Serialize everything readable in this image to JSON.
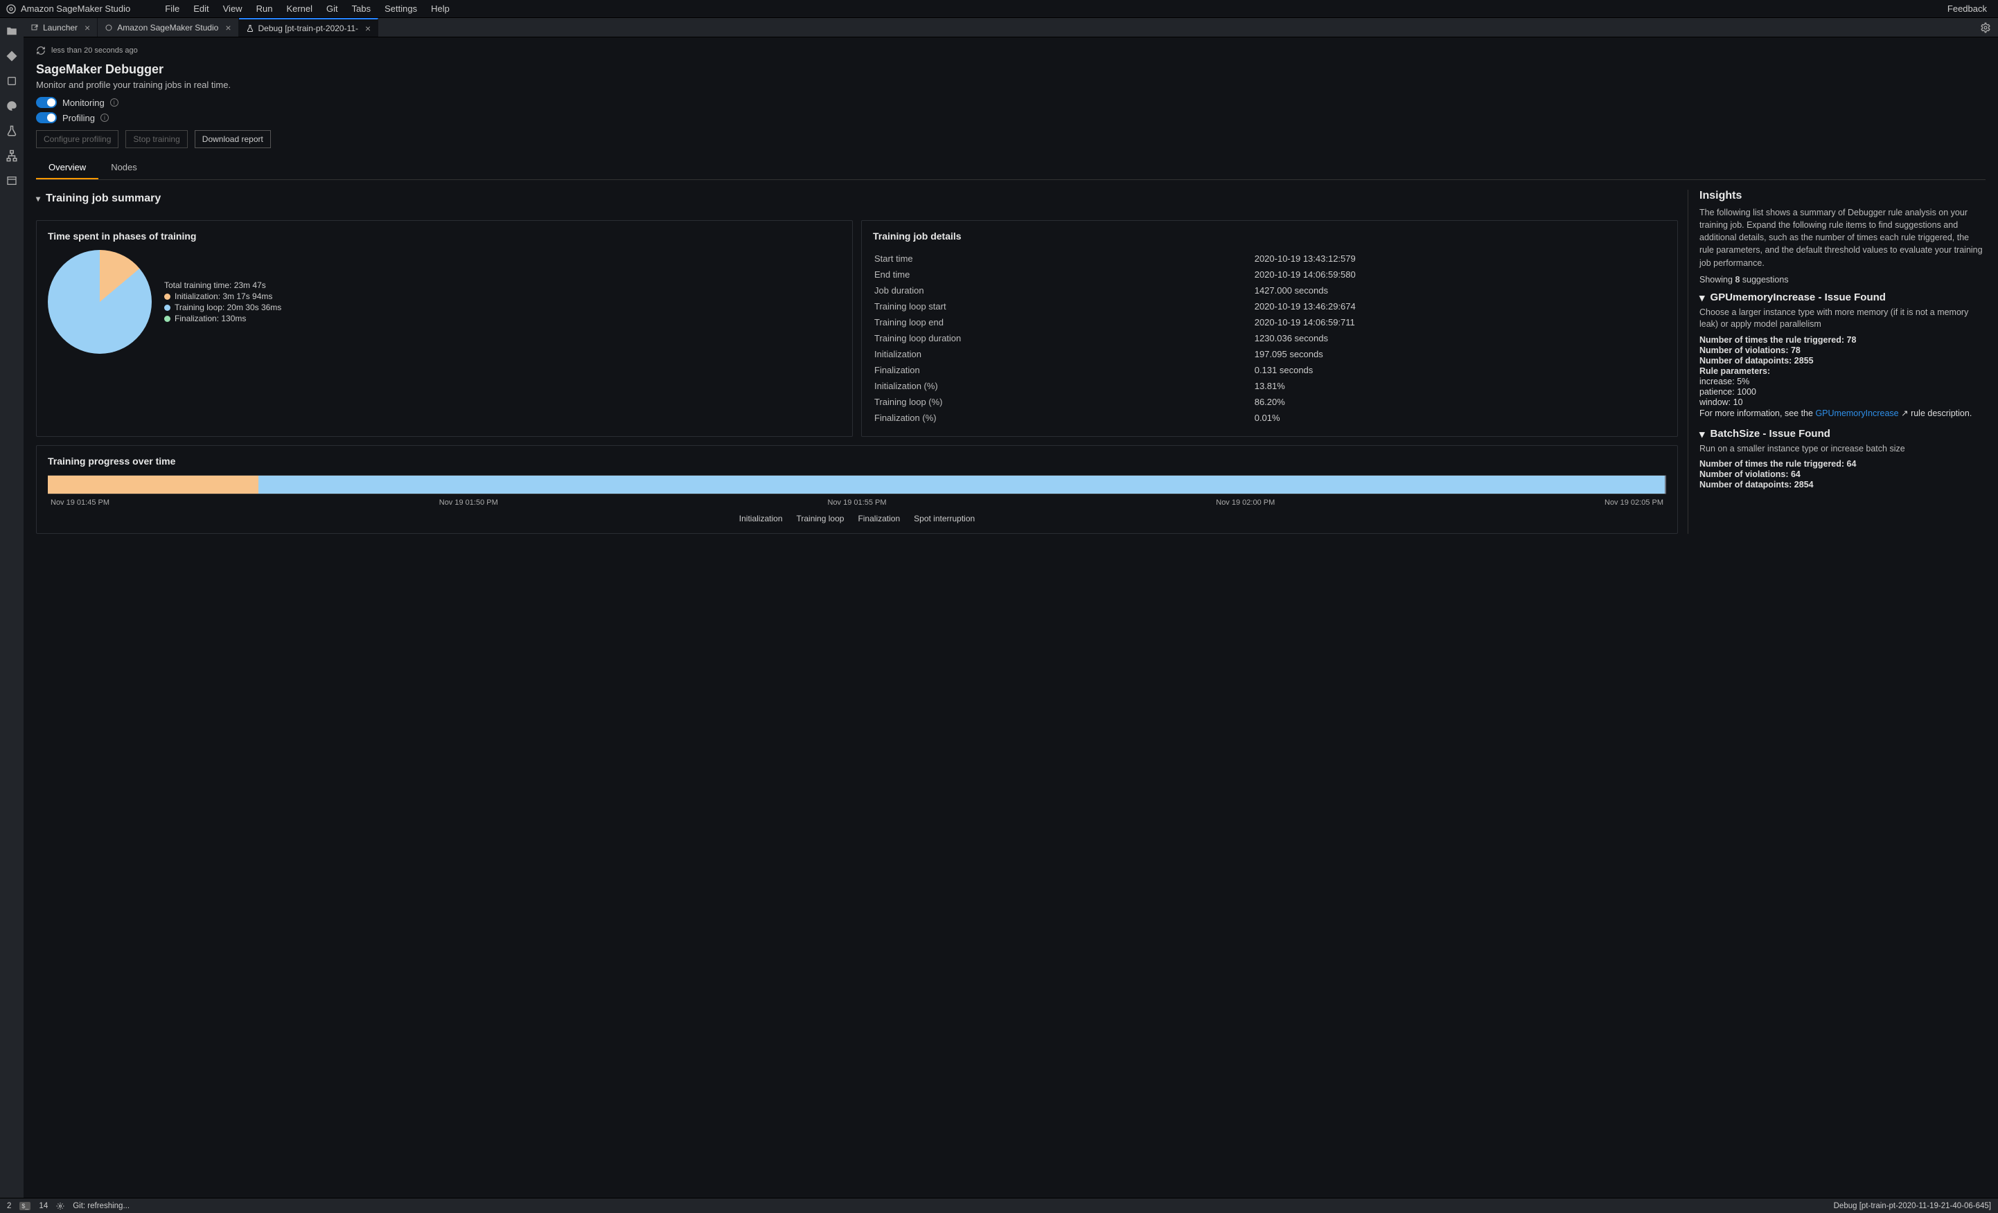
{
  "menubar": {
    "brand": "Amazon SageMaker Studio",
    "items": [
      "File",
      "Edit",
      "View",
      "Run",
      "Kernel",
      "Git",
      "Tabs",
      "Settings",
      "Help"
    ],
    "feedback": "Feedback"
  },
  "tabs": [
    {
      "label": "Launcher",
      "icon": "launch-icon",
      "active": false
    },
    {
      "label": "Amazon SageMaker Studio",
      "icon": "sagemaker-icon",
      "active": false
    },
    {
      "label": "Debug [pt-train-pt-2020-11-",
      "icon": "flask-icon",
      "active": true
    }
  ],
  "refresh": {
    "label": "less than 20 seconds ago"
  },
  "header": {
    "title": "SageMaker Debugger",
    "subtitle": "Monitor and profile your training jobs in real time."
  },
  "toggles": {
    "monitoring": {
      "label": "Monitoring",
      "on": true
    },
    "profiling": {
      "label": "Profiling",
      "on": true
    }
  },
  "buttons": {
    "configure": "Configure profiling",
    "stop": "Stop training",
    "download": "Download report"
  },
  "viewtabs": {
    "overview": "Overview",
    "nodes": "Nodes"
  },
  "summary": {
    "section": "Training job summary",
    "phasesTitle": "Time spent in phases of training",
    "totalTime": "Total training time: 23m 47s",
    "legend": {
      "init": "Initialization: 3m 17s 94ms",
      "loop": "Training loop: 20m 30s 36ms",
      "final": "Finalization: 130ms"
    },
    "detailsTitle": "Training job details",
    "details": [
      [
        "Start time",
        "2020-10-19 13:43:12:579"
      ],
      [
        "End time",
        "2020-10-19 14:06:59:580"
      ],
      [
        "Job duration",
        "1427.000 seconds"
      ],
      [
        "Training loop start",
        "2020-10-19 13:46:29:674"
      ],
      [
        "Training loop end",
        "2020-10-19 14:06:59:711"
      ],
      [
        "Training loop duration",
        "1230.036 seconds"
      ],
      [
        "Initialization",
        "197.095 seconds"
      ],
      [
        "Finalization",
        "0.131 seconds"
      ],
      [
        "Initialization (%)",
        "13.81%"
      ],
      [
        "Training loop (%)",
        "86.20%"
      ],
      [
        "Finalization (%)",
        "0.01%"
      ]
    ]
  },
  "progress": {
    "title": "Training progress over time",
    "axis": [
      "Nov 19 01:45 PM",
      "Nov 19 01:50 PM",
      "Nov 19 01:55 PM",
      "Nov 19 02:00 PM",
      "Nov 19 02:05 PM"
    ],
    "legend": [
      "Initialization",
      "Training loop",
      "Finalization",
      "Spot interruption"
    ]
  },
  "chart_data": [
    {
      "type": "pie",
      "title": "Time spent in phases of training",
      "series": [
        {
          "name": "Initialization",
          "value": 13.81,
          "seconds": 197.095,
          "color": "#f8c38a"
        },
        {
          "name": "Training loop",
          "value": 86.2,
          "seconds": 1230.036,
          "color": "#9ad0f5"
        },
        {
          "name": "Finalization",
          "value": 0.01,
          "seconds": 0.131,
          "color": "#98e2b1"
        }
      ],
      "total_label": "23m 47s"
    },
    {
      "type": "bar",
      "title": "Training progress over time",
      "orientation": "horizontal-stacked",
      "x_axis": {
        "ticks": [
          "Nov 19 01:45 PM",
          "Nov 19 01:50 PM",
          "Nov 19 01:55 PM",
          "Nov 19 02:00 PM",
          "Nov 19 02:05 PM"
        ]
      },
      "series": [
        {
          "name": "Initialization",
          "percent": 13.81,
          "color": "#f8c38a"
        },
        {
          "name": "Training loop",
          "percent": 86.2,
          "color": "#9ad0f5"
        },
        {
          "name": "Finalization",
          "percent": 0.01,
          "color": "#98e2b1"
        },
        {
          "name": "Spot interruption",
          "percent": 0,
          "color": "#f4d35e"
        }
      ]
    }
  ],
  "insights": {
    "heading": "Insights",
    "desc": "The following list shows a summary of Debugger rule analysis on your training job. Expand the following rule items to find suggestions and additional details, such as the number of times each rule triggered, the rule parameters, and the default threshold values to evaluate your training job performance.",
    "showing_prefix": "Showing ",
    "showing_count": "8",
    "showing_suffix": " suggestions",
    "rules": [
      {
        "name": "GPUmemoryIncrease - Issue Found",
        "desc": "Choose a larger instance type with more memory (if it is not a memory leak) or apply model parallelism",
        "triggered": "Number of times the rule triggered: 78",
        "violations": "Number of violations: 78",
        "datapoints": "Number of datapoints: 2855",
        "params_label": "Rule parameters:",
        "params": [
          "increase: 5%",
          "patience: 1000",
          "window: 10"
        ],
        "more_prefix": "For more information, see the ",
        "link": "GPUmemoryIncrease",
        "more_suffix": " rule description."
      },
      {
        "name": "BatchSize - Issue Found",
        "desc": "Run on a smaller instance type or increase batch size",
        "triggered": "Number of times the rule triggered: 64",
        "violations": "Number of violations: 64",
        "datapoints": "Number of datapoints: 2854"
      }
    ]
  },
  "statusbar": {
    "left_num": "2",
    "tabs_count": "14",
    "git": "Git: refreshing...",
    "right": "Debug [pt-train-pt-2020-11-19-21-40-06-645]"
  }
}
